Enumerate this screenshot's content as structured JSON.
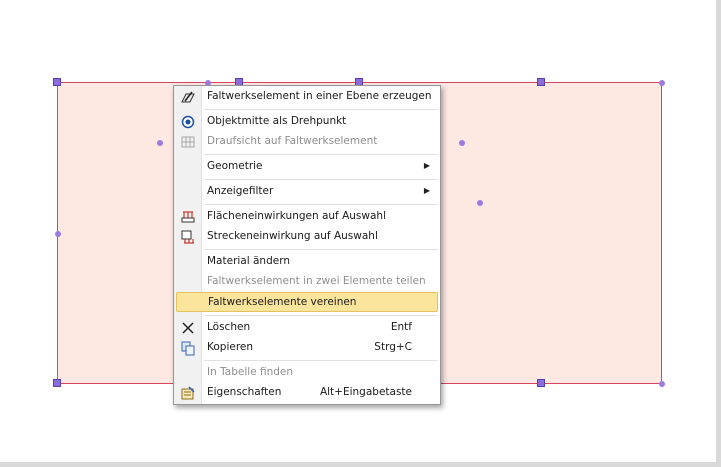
{
  "menu": {
    "items": [
      {
        "label": "Faltwerkselement in einer Ebene erzeugen",
        "icon": "pencil-plane-icon"
      },
      {
        "label": "Objektmitte als Drehpunkt",
        "icon": "target-icon"
      },
      {
        "label": "Draufsicht auf Faltwerkselement",
        "icon": "grid-view-icon"
      },
      {
        "label": "Geometrie"
      },
      {
        "label": "Anzeigefilter"
      },
      {
        "label": "Flächeneinwirkungen auf Auswahl",
        "icon": "area-load-icon"
      },
      {
        "label": "Streckeneinwirkung auf Auswahl",
        "icon": "line-load-icon"
      },
      {
        "label": "Material ändern"
      },
      {
        "label": "Faltwerkselement in zwei Elemente teilen"
      },
      {
        "label": "Faltwerkselemente vereinen"
      },
      {
        "label": "Löschen",
        "shortcut": "Entf",
        "icon": "delete-x-icon"
      },
      {
        "label": "Kopieren",
        "shortcut": "Strg+C",
        "icon": "copy-icon"
      },
      {
        "label": "In Tabelle finden"
      },
      {
        "label": "Eigenschaften",
        "shortcut": "Alt+Eingabetaste",
        "icon": "properties-icon"
      }
    ]
  },
  "colors": {
    "element_fill": "#fde8e2",
    "element_border": "#d9455f",
    "handle": "#8a6dd8",
    "highlight": "#fbe49c"
  }
}
